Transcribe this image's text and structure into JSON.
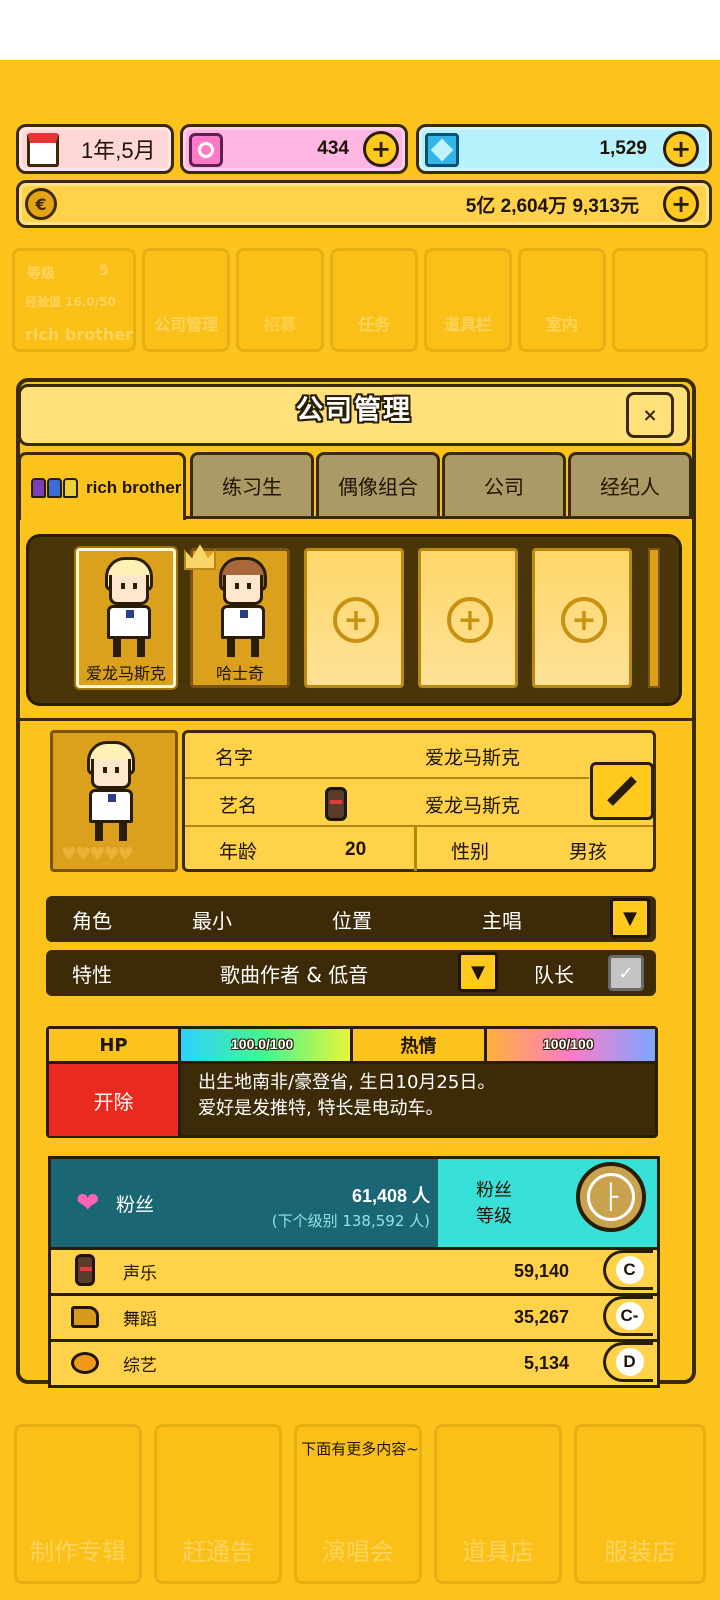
{
  "resources": {
    "date": "1年,5月",
    "gems": "434",
    "diamonds": "1,529",
    "money": "5亿 2,604万 9,313元"
  },
  "background_menu": {
    "level_label": "等级",
    "level_value": "5",
    "exp_label": "经验值 16.0/50",
    "company_name": "rich brother",
    "items": [
      "公司管理",
      "招募",
      "任务",
      "道具栏",
      "室内"
    ]
  },
  "modal": {
    "title": "公司管理",
    "close_label": "×",
    "tabs": [
      "rich brother",
      "练习生",
      "偶像组合",
      "公司",
      "经纪人"
    ]
  },
  "members": [
    {
      "name": "爱龙马斯克"
    },
    {
      "name": "哈士奇"
    }
  ],
  "profile": {
    "name_label": "名字",
    "name_value": "爱龙马斯克",
    "stage_name_label": "艺名",
    "stage_name_value": "爱龙马斯克",
    "age_label": "年龄",
    "age_value": "20",
    "gender_label": "性别",
    "gender_value": "男孩",
    "role_label": "角色",
    "role_value": "最小",
    "position_label": "位置",
    "position_value": "主唱",
    "trait_label": "特性",
    "trait_value": "歌曲作者 & 低音",
    "leader_label": "队长"
  },
  "status": {
    "hp_label": "HP",
    "hp_value": "100.0/100",
    "hp_fraction": 1.0,
    "passion_label": "热情",
    "passion_value": "100/100",
    "passion_fraction": 1.0,
    "fire_label": "开除",
    "bio_line1": "出生地南非/豪登省, 生日10月25日。",
    "bio_line2": "爱好是发推特, 特长是电动车。"
  },
  "fans": {
    "label": "粉丝",
    "count": "61,408 人",
    "next_level": "(下个级别 138,592 人)",
    "level_label_1": "粉丝",
    "level_label_2": "等级"
  },
  "stats": [
    {
      "label": "声乐",
      "value": "59,140",
      "grade": "C"
    },
    {
      "label": "舞蹈",
      "value": "35,267",
      "grade": "C-"
    },
    {
      "label": "综艺",
      "value": "5,134",
      "grade": "D"
    }
  ],
  "more_hint": "下面有更多内容~",
  "bottom_nav": [
    "制作专辑",
    "赶通告",
    "演唱会",
    "道具店",
    "服装店"
  ],
  "colors": {
    "background": "#fcc31d",
    "dark": "#3d2b08",
    "fire": "#ea2a1f",
    "fans_teal": "#1b6674",
    "fans_level_cyan": "#37e1d7"
  }
}
